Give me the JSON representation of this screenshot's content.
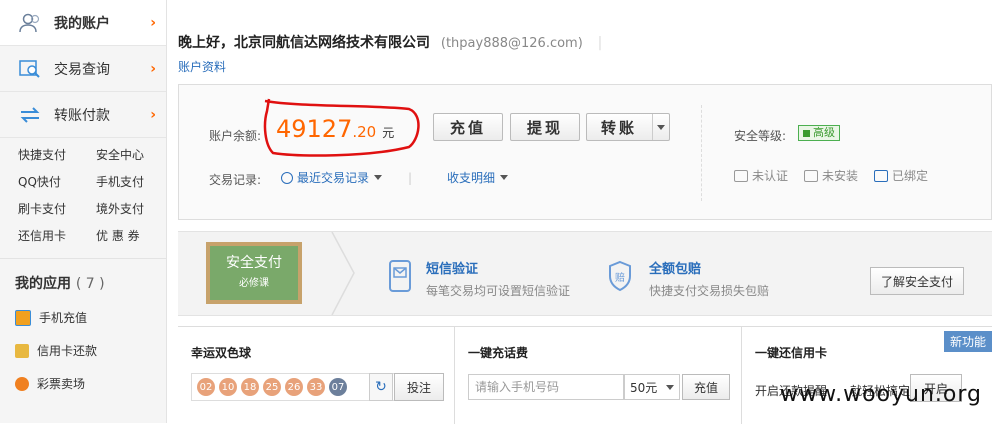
{
  "sidebar": {
    "main_nav": [
      {
        "label": "我的账户",
        "icon": "user-icon"
      },
      {
        "label": "交易查询",
        "icon": "search-doc-icon"
      },
      {
        "label": "转账付款",
        "icon": "transfer-icon"
      }
    ],
    "quick_links": [
      "快捷支付",
      "安全中心",
      "QQ快付",
      "手机支付",
      "刷卡支付",
      "境外支付",
      "还信用卡",
      "优 惠 券"
    ],
    "apps_title": "我的应用",
    "apps_count": "( 7 )",
    "apps": [
      {
        "label": "手机充值",
        "icon": "phone-recharge-icon",
        "color": "#f0a020"
      },
      {
        "label": "信用卡还款",
        "icon": "credit-card-icon",
        "color": "#e0a030"
      },
      {
        "label": "彩票卖场",
        "icon": "lottery-icon",
        "color": "#f08020"
      }
    ]
  },
  "header": {
    "greeting": "晚上好，北京同航信达网络技术有限公司",
    "email": "(thpay888@126.com)",
    "account_link": "账户资料"
  },
  "balance": {
    "label": "账户余额:",
    "amount_int": "49127",
    "amount_dec": ".20",
    "unit": "元",
    "buttons": [
      "充值",
      "提现",
      "转账"
    ],
    "records_label": "交易记录:",
    "recent_label": "最近交易记录",
    "income_label": "收支明细",
    "security_label": "安全等级:",
    "security_level": "高级",
    "security_items": [
      "未认证",
      "未安装",
      "已绑定"
    ]
  },
  "banner": {
    "board_text": "安全支付",
    "board_sub": "必修课",
    "features": [
      {
        "title": "短信验证",
        "desc": "每笔交易均可设置短信验证"
      },
      {
        "title": "全额包赔",
        "desc": "快捷支付交易损失包赔"
      }
    ],
    "learn_button": "了解安全支付"
  },
  "panels": {
    "lottery": {
      "title": "幸运双色球",
      "red_balls": [
        "02",
        "10",
        "18",
        "25",
        "26",
        "33"
      ],
      "blue_ball": "07",
      "bet_button": "投注"
    },
    "phone": {
      "title": "一键充话费",
      "placeholder": "请输入手机号码",
      "amount": "50元",
      "button": "充值"
    },
    "credit": {
      "title": "一键还信用卡",
      "new_tag": "新功能",
      "text1": "开启还款提醒",
      "text2": "就轻松搞定",
      "button": "开启"
    }
  },
  "watermark": "www.wooyun.org",
  "colors": {
    "accent": "#ff6600",
    "link": "#2a6ebb",
    "secure": "#3a9b2e",
    "annotation": "#e01010"
  }
}
